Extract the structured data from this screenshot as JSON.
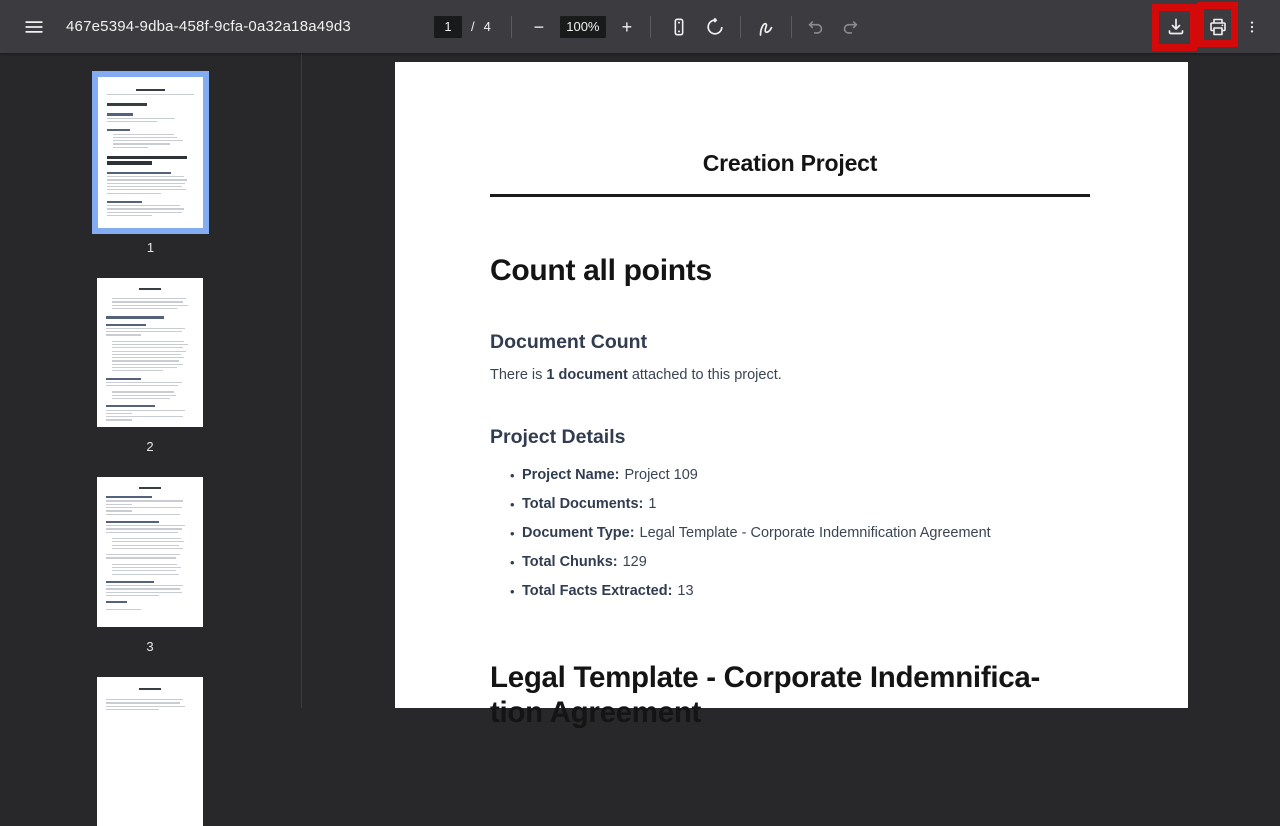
{
  "colors": {
    "selection_blue": "#83acf2",
    "annotation_red": "#d40a0a",
    "toolbar_bg": "#3c3c40",
    "viewer_bg": "#28282a"
  },
  "toolbar": {
    "title": "467e5394-9dba-458f-9cfa-0a32a18a49d3",
    "page_input_value": "1",
    "page_separator": "/",
    "page_count": "4",
    "zoom_out_glyph": "−",
    "zoom_level": "100%",
    "zoom_in_glyph": "+",
    "icons": [
      "menu-icon",
      "fit-to-page-icon",
      "rotate-ccw-icon",
      "annotate-icon",
      "undo-icon",
      "redo-icon",
      "download-icon",
      "print-icon",
      "more-vertical-icon"
    ]
  },
  "sidebar": {
    "thumbnails": [
      {
        "page": "1",
        "selected": true
      },
      {
        "page": "2",
        "selected": false
      },
      {
        "page": "3",
        "selected": false
      },
      {
        "page": "4",
        "selected": false
      }
    ]
  },
  "document": {
    "title": "Creation Project",
    "count_heading": "Count all points",
    "document_count": {
      "heading": "Document Count",
      "prefix": "There is ",
      "bold": "1 document",
      "suffix": " attached to this project."
    },
    "project_details": {
      "heading": "Project Details",
      "items": [
        {
          "label": "Project Name:",
          "value": "Project 109"
        },
        {
          "label": "Total Documents:",
          "value": "1"
        },
        {
          "label": "Document Type:",
          "value": "Legal Template - Corporate Indemnification Agreement"
        },
        {
          "label": "Total Chunks:",
          "value": "129"
        },
        {
          "label": "Total Facts Extracted:",
          "value": "13"
        }
      ]
    },
    "legal_heading_line1": "Legal Template - Corporate Indemnifica-",
    "legal_heading_line2": "tion Agreement"
  }
}
